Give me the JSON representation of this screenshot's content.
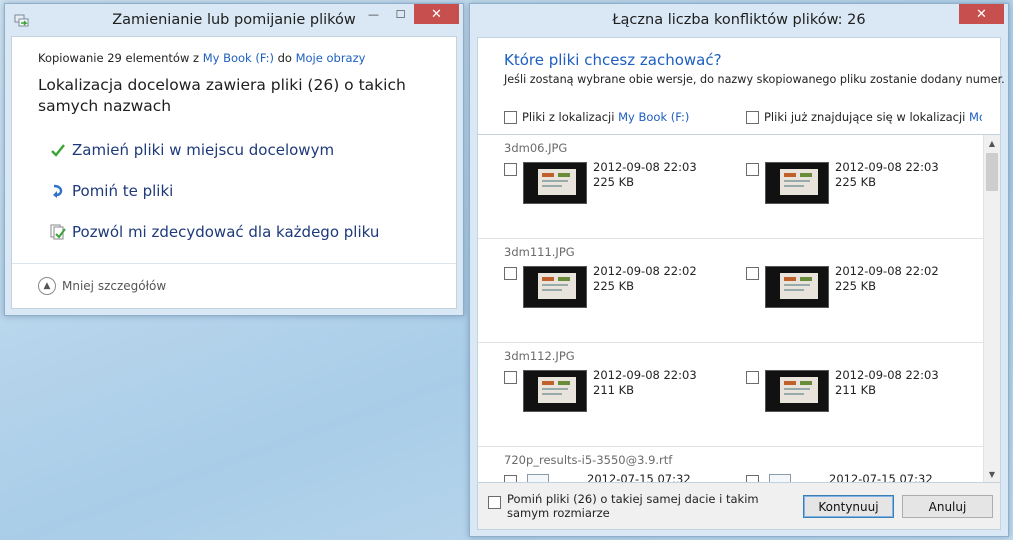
{
  "left_window": {
    "title": "Zamienianie lub pomijanie plików",
    "copy_info": {
      "prefix": "Kopiowanie 29 elementów z",
      "source": "My Book (F:)",
      "middle": "do",
      "destination": "Moje obrazy"
    },
    "heading": "Lokalizacja docelowa zawiera pliki (26) o takich samych nazwach",
    "options": [
      {
        "label": "Zamień pliki w miejscu docelowym",
        "icon": "green-check-icon"
      },
      {
        "label": "Pomiń te pliki",
        "icon": "skip-arrow-icon"
      },
      {
        "label": "Pozwól mi zdecydować dla każdego pliku",
        "icon": "decide-files-icon"
      }
    ],
    "less_details": "Mniej szczegółów"
  },
  "right_window": {
    "title": "Łączna liczba konfliktów plików: 26",
    "question": "Które pliki chcesz zachować?",
    "description": "Jeśli zostaną wybrane obie wersje, do nazwy skopiowanego pliku zostanie dodany numer.",
    "col_source_prefix": "Pliki z lokalizacji",
    "col_source_link": "My Book (F:)",
    "col_dest_prefix": "Pliki już znajdujące się w lokalizacji",
    "col_dest_link": "Mo...",
    "files": [
      {
        "name": "3dm06.JPG",
        "src_date": "2012-09-08 22:03",
        "src_size": "225 KB",
        "dst_date": "2012-09-08 22:03",
        "dst_size": "225 KB",
        "kind": "image"
      },
      {
        "name": "3dm111.JPG",
        "src_date": "2012-09-08 22:02",
        "src_size": "225 KB",
        "dst_date": "2012-09-08 22:02",
        "dst_size": "225 KB",
        "kind": "image"
      },
      {
        "name": "3dm112.JPG",
        "src_date": "2012-09-08 22:03",
        "src_size": "211 KB",
        "dst_date": "2012-09-08 22:03",
        "dst_size": "211 KB",
        "kind": "image"
      },
      {
        "name": "720p_results-i5-3550@3.9.rtf",
        "src_date": "2012-07-15 07:32",
        "src_size": "",
        "dst_date": "2012-07-15 07:32",
        "dst_size": "",
        "kind": "document"
      }
    ],
    "skip_same": "Pomiń pliki (26) o takiej samej dacie i takim samym rozmiarze",
    "continue_label": "Kontynuuj",
    "cancel_label": "Anuluj"
  },
  "window_buttons": {
    "minimize": "—",
    "maximize": "☐",
    "close": "✕"
  },
  "colors": {
    "link": "#1d5fc0",
    "close": "#c7504f",
    "check": "#3aa335"
  }
}
